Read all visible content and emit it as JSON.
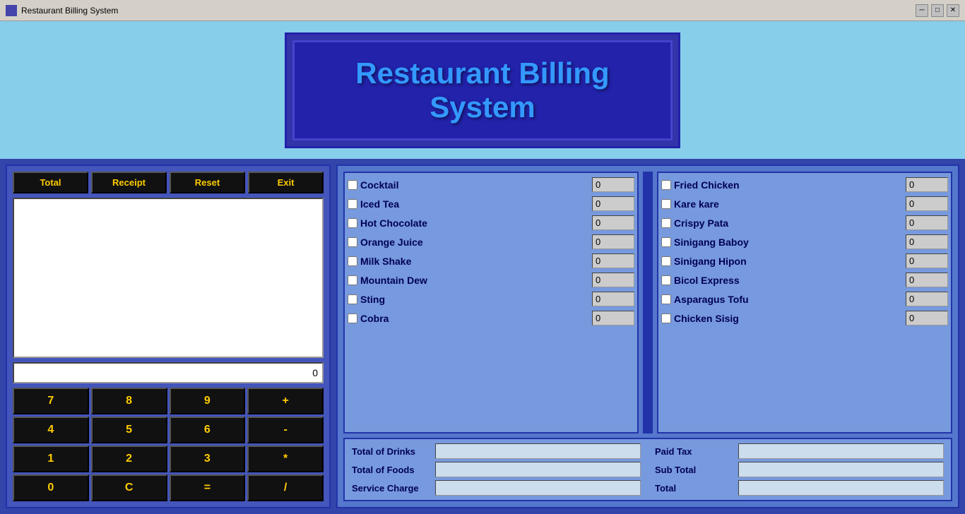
{
  "titleBar": {
    "title": "Restaurant Billing System",
    "icon": "app-icon",
    "controls": [
      "minimize",
      "maximize",
      "close"
    ]
  },
  "header": {
    "title": "Restaurant Billing System"
  },
  "leftPanel": {
    "buttons": [
      {
        "label": "Total",
        "name": "total-button"
      },
      {
        "label": "Receipt",
        "name": "receipt-button"
      },
      {
        "label": "Reset",
        "name": "reset-button"
      },
      {
        "label": "Exit",
        "name": "exit-button"
      }
    ],
    "calcDisplay": "0",
    "calcButtons": [
      "7",
      "8",
      "9",
      "+",
      "4",
      "5",
      "6",
      "-",
      "1",
      "2",
      "3",
      "*",
      "0",
      "C",
      "=",
      "/"
    ]
  },
  "drinks": {
    "items": [
      {
        "label": "Cocktail",
        "value": "0"
      },
      {
        "label": "Iced Tea",
        "value": "0"
      },
      {
        "label": "Hot Chocolate",
        "value": "0"
      },
      {
        "label": "Orange Juice",
        "value": "0"
      },
      {
        "label": "Milk Shake",
        "value": "0"
      },
      {
        "label": "Mountain Dew",
        "value": "0"
      },
      {
        "label": "Sting",
        "value": "0"
      },
      {
        "label": "Cobra",
        "value": "0"
      }
    ]
  },
  "foods": {
    "items": [
      {
        "label": "Fried Chicken",
        "value": "0"
      },
      {
        "label": "Kare kare",
        "value": "0"
      },
      {
        "label": "Crispy Pata",
        "value": "0"
      },
      {
        "label": "Sinigang Baboy",
        "value": "0"
      },
      {
        "label": "Sinigang Hipon",
        "value": "0"
      },
      {
        "label": "Bicol Express",
        "value": "0"
      },
      {
        "label": "Asparagus Tofu",
        "value": "0"
      },
      {
        "label": "Chicken Sisig",
        "value": "0"
      }
    ]
  },
  "totals": {
    "left": [
      {
        "label": "Total of Drinks",
        "name": "total-drinks"
      },
      {
        "label": "Total of Foods",
        "name": "total-foods"
      },
      {
        "label": "Service Charge",
        "name": "service-charge"
      }
    ],
    "right": [
      {
        "label": "Paid Tax",
        "name": "paid-tax"
      },
      {
        "label": "Sub Total",
        "name": "sub-total"
      },
      {
        "label": "Total",
        "name": "total"
      }
    ]
  }
}
